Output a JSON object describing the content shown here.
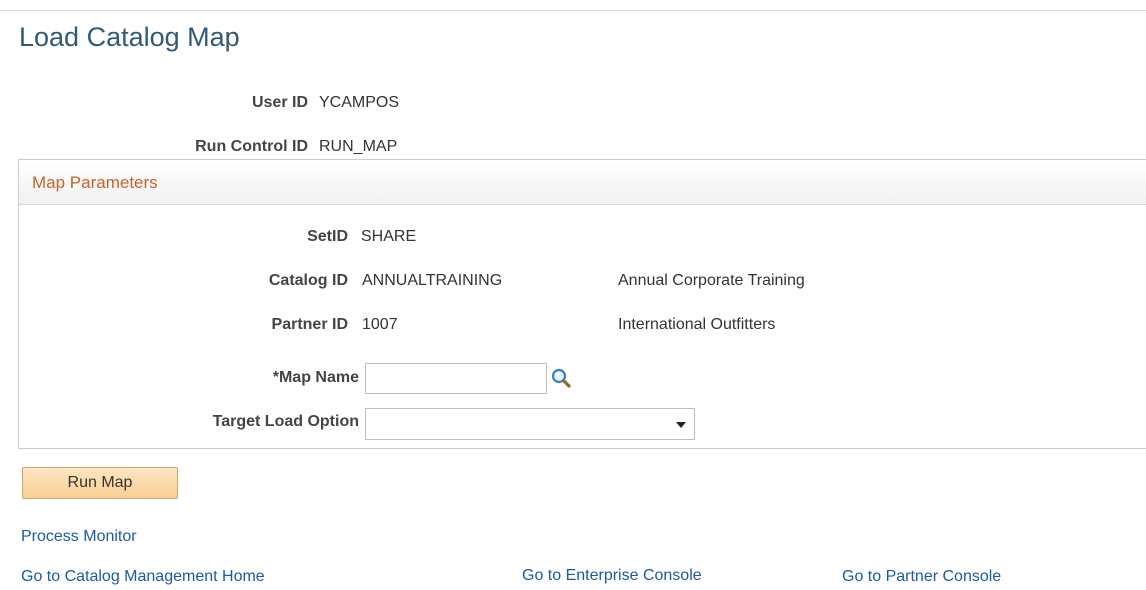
{
  "page": {
    "title": "Load Catalog Map"
  },
  "header": {
    "user_id_label": "User ID",
    "user_id_value": "YCAMPOS",
    "run_control_label": "Run Control ID",
    "run_control_value": "RUN_MAP"
  },
  "map_parameters": {
    "title": "Map Parameters",
    "setid_label": "SetID",
    "setid_value": "SHARE",
    "catalog_label": "Catalog ID",
    "catalog_value": "ANNUALTRAINING",
    "catalog_desc": "Annual Corporate Training",
    "partner_label": "Partner ID",
    "partner_value": "1007",
    "partner_desc": "International Outfitters",
    "map_name_label": "*Map Name",
    "map_name_value": "",
    "target_load_label": "Target Load Option",
    "target_load_value": ""
  },
  "actions": {
    "run_map_label": "Run Map"
  },
  "links": {
    "process_monitor": "Process Monitor",
    "catalog_home": "Go to Catalog Management Home",
    "enterprise_console": "Go to Enterprise Console",
    "partner_console": "Go to Partner Console"
  },
  "icons": {
    "lookup": "magnifying-glass-icon",
    "dropdown": "chevron-down-icon"
  },
  "colors": {
    "title": "#2f5a7c",
    "group_title": "#c6632c",
    "link": "#1a5aa8",
    "button": "#f8ce92"
  }
}
